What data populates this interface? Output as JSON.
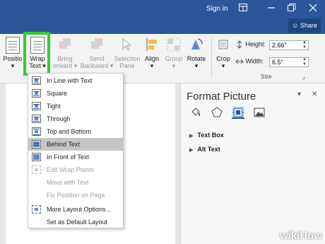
{
  "titlebar": {
    "sign_in": "Sign in",
    "icons": [
      "ribbon-display-icon",
      "minimize-icon",
      "restore-icon",
      "close-icon"
    ],
    "bg_color": "#2b579a"
  },
  "share": {
    "label": "Share"
  },
  "ribbon": {
    "position": {
      "line1": "Positio",
      "line2": "▾"
    },
    "wrap_text": {
      "line1": "Wrap",
      "line2": "Text ▾"
    },
    "bring_forward": {
      "line1": "Bring",
      "line2": "orward ▾"
    },
    "send_backward": {
      "line1": "Send",
      "line2": "Backward ▾"
    },
    "selection_pane": {
      "line1": "Selection",
      "line2": "Pane"
    },
    "align": {
      "line1": "Align",
      "line2": "▾"
    },
    "group": {
      "line1": "Group",
      "line2": "▾"
    },
    "rotate": {
      "line1": "Rotate",
      "line2": "▾"
    },
    "crop": {
      "line1": "Crop",
      "line2": "▾"
    },
    "height_label": "Height:",
    "height_value": "2.66\"",
    "width_label": "Width:",
    "width_value": "6.5\"",
    "size_group": "Size",
    "highlight_color": "#33cc33"
  },
  "menu": {
    "items": [
      {
        "label": "In Line with Text",
        "enabled": true
      },
      {
        "label": "Square",
        "enabled": true
      },
      {
        "label": "Tight",
        "enabled": true
      },
      {
        "label": "Through",
        "enabled": true
      },
      {
        "label": "Top and Bottom",
        "enabled": true
      },
      {
        "label": "Behind Text",
        "enabled": true,
        "selected": true
      },
      {
        "label": "In Front of Text",
        "enabled": true
      },
      {
        "label": "Edit Wrap Points",
        "enabled": false
      },
      {
        "label": "Move with Text",
        "enabled": false
      },
      {
        "label": "Fix Position on Page",
        "enabled": false
      },
      {
        "label": "More Layout Options...",
        "enabled": true
      },
      {
        "label": "Set as Default Layout",
        "enabled": true
      }
    ]
  },
  "pane": {
    "title": "Format Picture",
    "dropdown": "▾",
    "close": "✕",
    "icons": [
      "fill-line-icon",
      "effects-icon",
      "layout-properties-icon",
      "picture-icon"
    ],
    "sections": [
      "Text Box",
      "Alt Text"
    ]
  },
  "watermark": {
    "text": "wikiHow"
  }
}
